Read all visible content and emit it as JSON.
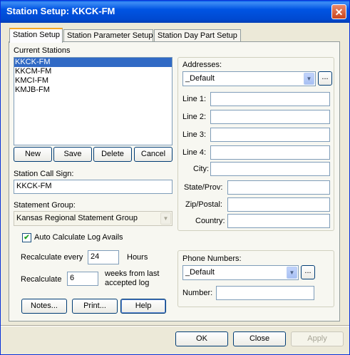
{
  "window": {
    "title": "Station Setup: KKCK-FM",
    "close_glyph": "✕"
  },
  "tabs": [
    {
      "label": "Station Setup",
      "active": true
    },
    {
      "label": "Station Parameter Setup",
      "active": false
    },
    {
      "label": "Station Day Part Setup",
      "active": false
    }
  ],
  "stations": {
    "label": "Current Stations",
    "items": [
      "KKCK-FM",
      "KKCM-FM",
      "KMCI-FM",
      "KMJB-FM"
    ],
    "selected": "KKCK-FM",
    "buttons": {
      "new": "New",
      "save": "Save",
      "delete": "Delete",
      "cancel": "Cancel"
    }
  },
  "call_sign": {
    "label": "Station Call Sign:",
    "value": "KKCK-FM"
  },
  "statement_group": {
    "label": "Statement Group:",
    "value": "Kansas Regional Statement Group"
  },
  "auto_calc": {
    "label": "Auto Calculate Log Avails",
    "checked": true,
    "check_glyph": "✔"
  },
  "recalc_every": {
    "label": "Recalculate every",
    "value": "24",
    "unit": "Hours"
  },
  "recalc_weeks": {
    "label": "Recalculate",
    "value": "6",
    "unit_line1": "weeks from last",
    "unit_line2": "accepted log"
  },
  "bottom_buttons": {
    "notes": "Notes...",
    "print": "Print...",
    "help": "Help"
  },
  "addresses": {
    "label": "Addresses:",
    "selected": "_Default",
    "ellipsis": "...",
    "fields": {
      "line1": {
        "label": "Line 1:",
        "value": ""
      },
      "line2": {
        "label": "Line 2:",
        "value": ""
      },
      "line3": {
        "label": "Line 3:",
        "value": ""
      },
      "line4": {
        "label": "Line 4:",
        "value": ""
      },
      "city": {
        "label": "City:",
        "value": ""
      },
      "state": {
        "label": "State/Prov:",
        "value": ""
      },
      "zip": {
        "label": "Zip/Postal:",
        "value": ""
      },
      "country": {
        "label": "Country:",
        "value": ""
      }
    }
  },
  "phone": {
    "label": "Phone Numbers:",
    "selected": "_Default",
    "ellipsis": "...",
    "number_label": "Number:",
    "number_value": ""
  },
  "dialog_buttons": {
    "ok": "OK",
    "close": "Close",
    "apply": "Apply"
  }
}
